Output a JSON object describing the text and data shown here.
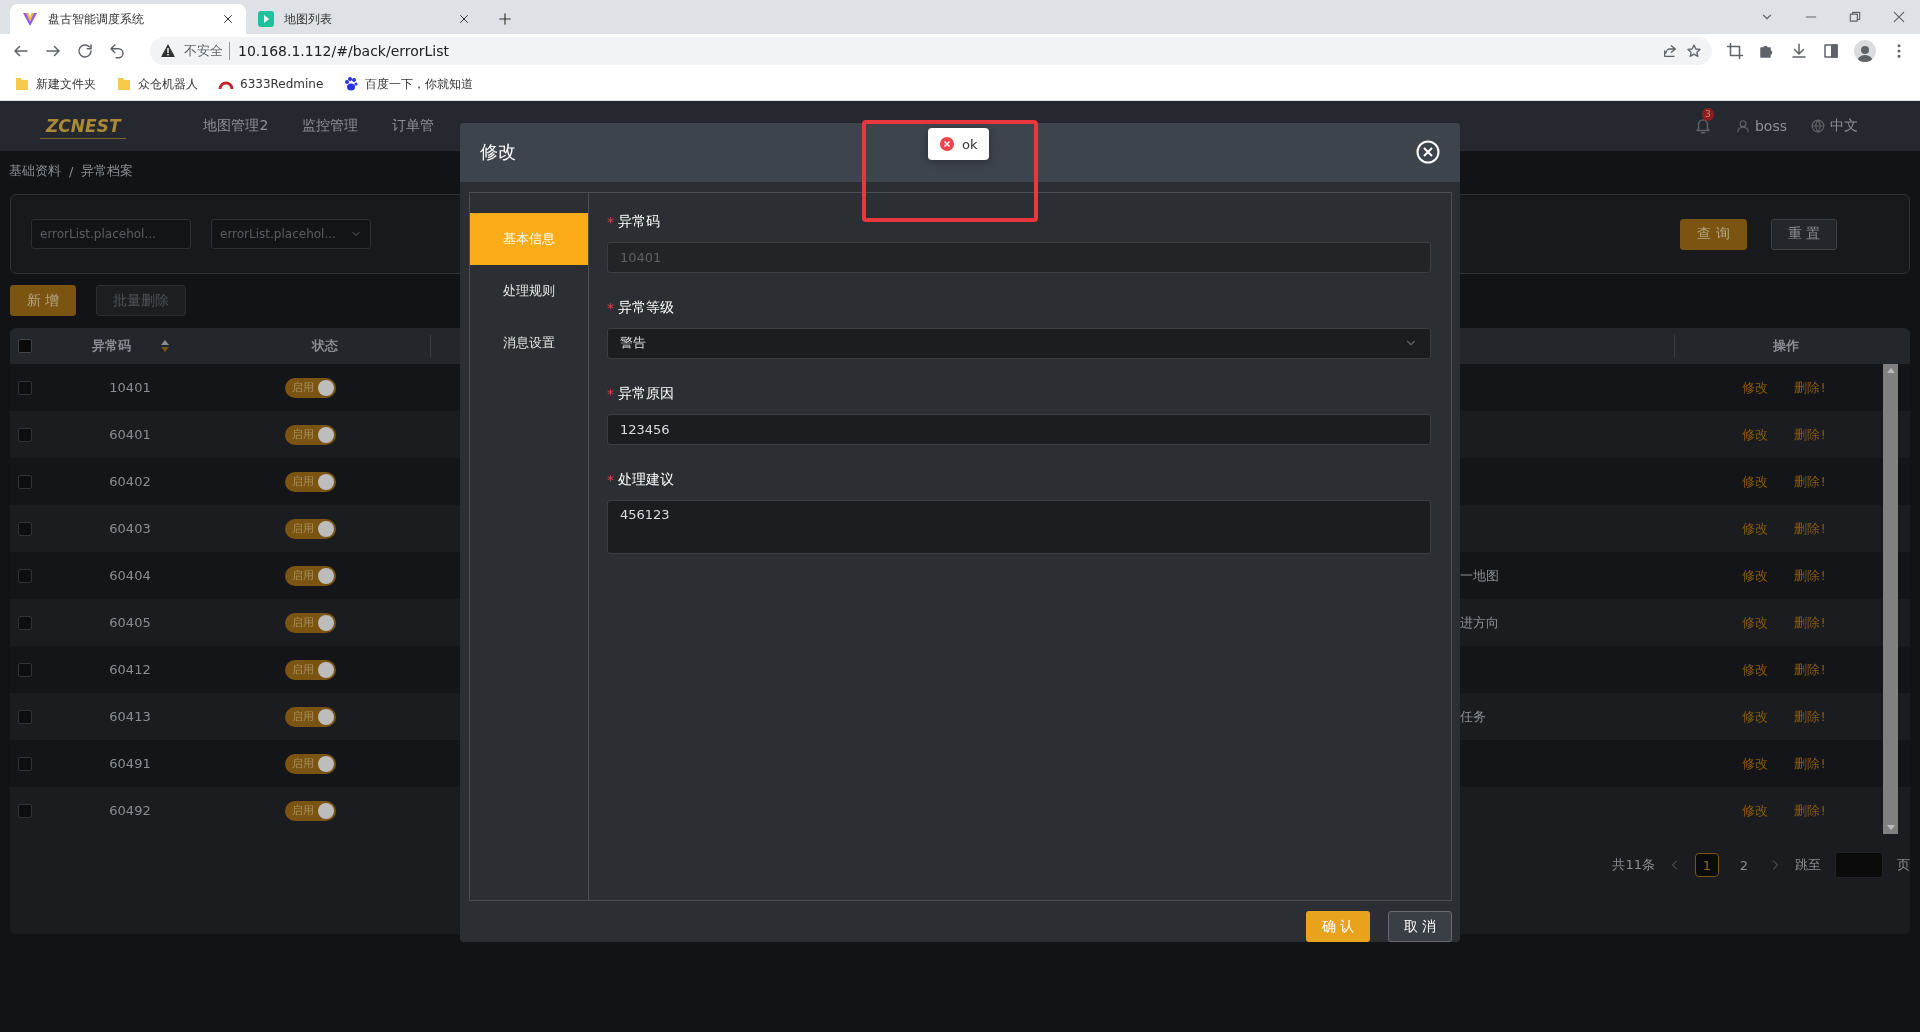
{
  "browser": {
    "tabs": [
      {
        "title": "盘古智能调度系统",
        "selected": true
      },
      {
        "title": "地图列表",
        "selected": false
      }
    ],
    "address": {
      "security": "不安全",
      "url": "10.168.1.112/#/back/errorList"
    },
    "bookmarks": [
      {
        "label": "新建文件夹"
      },
      {
        "label": "众仓机器人"
      },
      {
        "label": "6333Redmine"
      },
      {
        "label": "百度一下，你就知道"
      }
    ]
  },
  "app": {
    "logo": "ZCNEST",
    "nav": [
      "地图管理2",
      "监控管理",
      "订单管"
    ],
    "notifications": "3",
    "user": "boss",
    "language": "中文"
  },
  "breadcrumb": {
    "items": [
      "基础资料",
      "异常档案"
    ],
    "separator": "/"
  },
  "filters": [
    {
      "kind": "input",
      "placeholder": "errorList.placehol..."
    },
    {
      "kind": "select",
      "placeholder": "errorList.placehol..."
    }
  ],
  "filter_buttons": [
    {
      "label": "查 询",
      "kind": "primary"
    },
    {
      "label": "重 置",
      "kind": "default"
    }
  ],
  "actions": [
    {
      "label": "新 增",
      "disabled": false
    },
    {
      "label": "批量删除",
      "disabled": true
    }
  ],
  "table": {
    "all_checked": false,
    "columns": [
      {
        "label": "异常码",
        "sortable": true
      },
      {
        "label": "状态",
        "sortable": false
      },
      {
        "label": "操作",
        "sortable": false
      }
    ],
    "rows": [
      {
        "checked": false,
        "code": "10401",
        "status": "启用",
        "on": true,
        "column_3": "",
        "actions": [
          "修改",
          "删除!"
        ]
      },
      {
        "checked": false,
        "code": "60401",
        "status": "启用",
        "on": true,
        "column_3": "",
        "actions": [
          "修改",
          "删除!"
        ]
      },
      {
        "checked": false,
        "code": "60402",
        "status": "启用",
        "on": true,
        "column_3": "",
        "actions": [
          "修改",
          "删除!"
        ]
      },
      {
        "checked": false,
        "code": "60403",
        "status": "启用",
        "on": true,
        "column_3": "",
        "actions": [
          "修改",
          "删除!"
        ]
      },
      {
        "checked": false,
        "code": "60404",
        "status": "启用",
        "on": true,
        "column_3": "一地图",
        "actions": [
          "修改",
          "删除!"
        ]
      },
      {
        "checked": false,
        "code": "60405",
        "status": "启用",
        "on": true,
        "column_3": "进方向",
        "actions": [
          "修改",
          "删除!"
        ]
      },
      {
        "checked": false,
        "code": "60412",
        "status": "启用",
        "on": true,
        "column_3": "",
        "actions": [
          "修改",
          "删除!"
        ]
      },
      {
        "checked": false,
        "code": "60413",
        "status": "启用",
        "on": true,
        "column_3": "任务",
        "actions": [
          "修改",
          "删除!"
        ]
      },
      {
        "checked": false,
        "code": "60491",
        "status": "启用",
        "on": true,
        "column_3": "",
        "actions": [
          "修改",
          "删除!"
        ]
      },
      {
        "checked": false,
        "code": "60492",
        "status": "启用",
        "on": true,
        "column_3": "",
        "actions": [
          "修改",
          "删除!"
        ]
      }
    ]
  },
  "pagination": {
    "total": "共11条",
    "pages": [
      {
        "label": "1",
        "selected": true
      },
      {
        "label": "2",
        "selected": false
      }
    ],
    "jump": "跳至",
    "unit": "页"
  },
  "modal": {
    "title": "修改",
    "tabs": [
      {
        "label": "基本信息",
        "selected": true
      },
      {
        "label": "处理规则",
        "selected": false
      },
      {
        "label": "消息设置",
        "selected": false
      }
    ],
    "fields": [
      {
        "mark": "*",
        "label": "异常码",
        "kind": "input",
        "value": "10401",
        "disabled": true
      },
      {
        "mark": "*",
        "label": "异常等级",
        "kind": "select",
        "value": "警告",
        "disabled": false
      },
      {
        "mark": "*",
        "label": "异常原因",
        "kind": "input",
        "value": "123456",
        "disabled": false
      },
      {
        "mark": "*",
        "label": "处理建议",
        "kind": "textarea",
        "value": "456123",
        "disabled": false
      }
    ],
    "buttons": [
      {
        "label": "确 认",
        "kind": "primary"
      },
      {
        "label": "取 消",
        "kind": "default"
      }
    ]
  },
  "toast": {
    "kind": "error",
    "message": "ok"
  }
}
